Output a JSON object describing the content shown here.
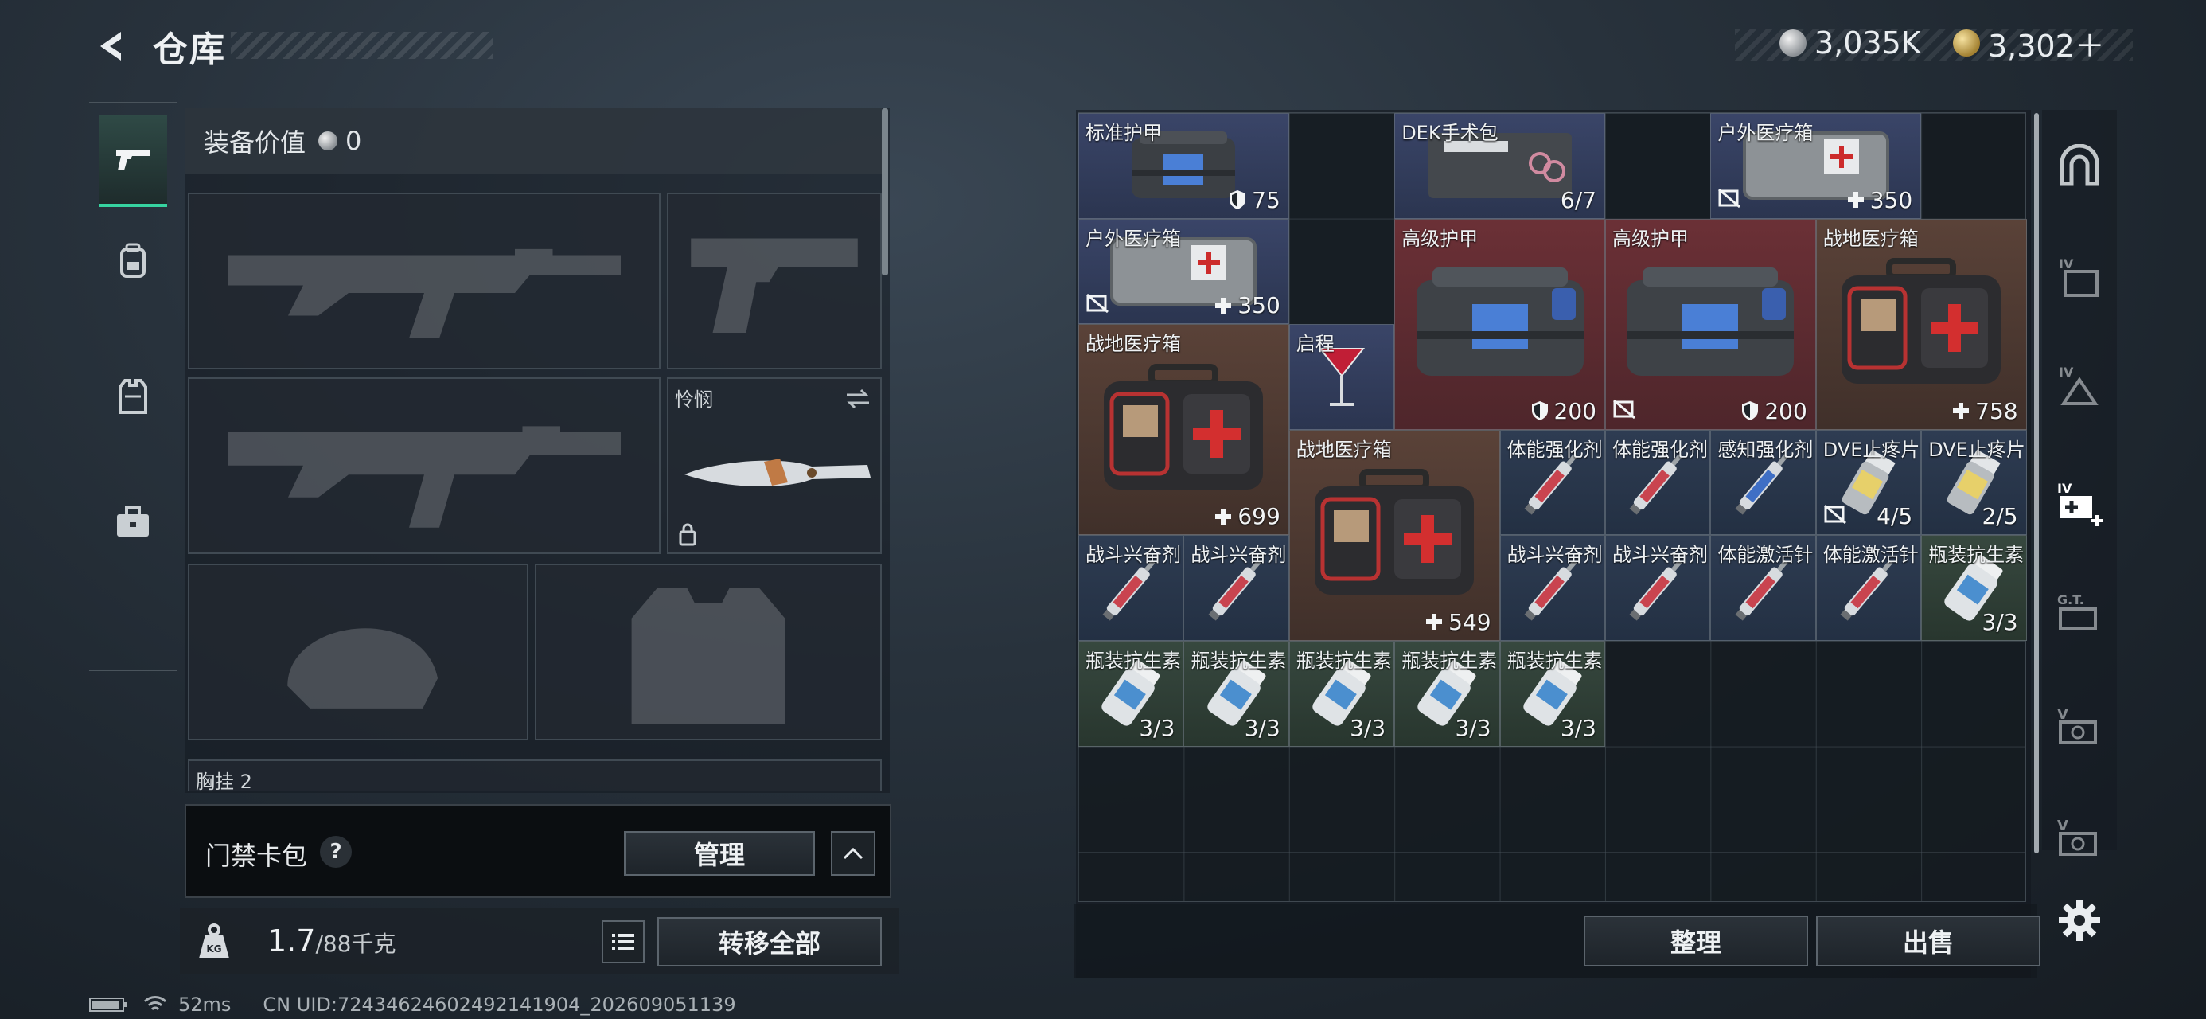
{
  "header": {
    "title": "仓库",
    "currency": [
      {
        "icon": "silver-coin-icon",
        "value": "3,035K"
      },
      {
        "icon": "gold-coin-icon",
        "value": "3,302＋"
      }
    ]
  },
  "left_tabs": [
    {
      "name": "tab-weapons",
      "icon": "pistol-icon",
      "active": true
    },
    {
      "name": "tab-backpack",
      "icon": "backpack-icon"
    },
    {
      "name": "tab-vest",
      "icon": "vest-icon"
    },
    {
      "name": "tab-case",
      "icon": "briefcase-icon"
    }
  ],
  "equipment": {
    "value_label": "装备价值",
    "value": "0",
    "melee_label": "怜悯",
    "chest_rig_label": "胸挂",
    "chest_rig_count": "2"
  },
  "keycard": {
    "label": "门禁卡包",
    "help": "?",
    "manage_label": "管理"
  },
  "weight": {
    "current": "1.7",
    "max": "/88千克",
    "icon_text": "KG",
    "transfer_all_label": "转移全部"
  },
  "status": {
    "ping": "52ms",
    "uid": "CN UID:72434624602492141904_202609051139"
  },
  "inventory": {
    "items": [
      {
        "name": "标准护甲",
        "value": "75",
        "mark": "shield",
        "color": "blue",
        "art": "armor-blue"
      },
      {
        "name": "DEK手术包",
        "value": "6/7",
        "mark": "",
        "color": "blue",
        "art": "surgery-kit"
      },
      {
        "name": "户外医疗箱",
        "value": "350",
        "mark": "plus",
        "color": "blue",
        "art": "medkit-gray",
        "nolock": true
      },
      {
        "name": "户外医疗箱",
        "value": "350",
        "mark": "plus",
        "color": "blue",
        "art": "medkit-gray",
        "nolock": true
      },
      {
        "name": "高级护甲",
        "value": "200",
        "mark": "shield",
        "color": "red",
        "art": "armor-large"
      },
      {
        "name": "高级护甲",
        "value": "200",
        "mark": "shield",
        "color": "red",
        "art": "armor-large",
        "nolock": true
      },
      {
        "name": "战地医疗箱",
        "value": "758",
        "mark": "plus",
        "color": "brown",
        "art": "firstaid"
      },
      {
        "name": "战地医疗箱",
        "value": "699",
        "mark": "plus",
        "color": "brown",
        "art": "firstaid"
      },
      {
        "name": "启程",
        "value": "",
        "mark": "",
        "color": "blue",
        "art": "cocktail"
      },
      {
        "name": "战地医疗箱",
        "value": "549",
        "mark": "plus",
        "color": "brown",
        "art": "firstaid"
      },
      {
        "name": "体能强化剂",
        "value": "",
        "mark": "",
        "color": "navy",
        "art": "syringe-red"
      },
      {
        "name": "体能强化剂",
        "value": "",
        "mark": "",
        "color": "navy",
        "art": "syringe-red"
      },
      {
        "name": "感知强化剂",
        "value": "",
        "mark": "",
        "color": "navy",
        "art": "syringe-blue"
      },
      {
        "name": "DVE止疼片",
        "value": "4/5",
        "mark": "",
        "color": "navy",
        "art": "pills",
        "nolock": true
      },
      {
        "name": "DVE止疼片",
        "value": "2/5",
        "mark": "",
        "color": "navy",
        "art": "pills"
      },
      {
        "name": "战斗兴奋剂",
        "value": "",
        "mark": "",
        "color": "navy",
        "art": "syringe-red"
      },
      {
        "name": "战斗兴奋剂",
        "value": "",
        "mark": "",
        "color": "navy",
        "art": "syringe-red"
      },
      {
        "name": "战斗兴奋剂",
        "value": "",
        "mark": "",
        "color": "navy",
        "art": "syringe-red"
      },
      {
        "name": "战斗兴奋剂",
        "value": "",
        "mark": "",
        "color": "navy",
        "art": "syringe-red"
      },
      {
        "name": "体能激活针",
        "value": "",
        "mark": "",
        "color": "navy",
        "art": "syringe-red"
      },
      {
        "name": "体能激活针",
        "value": "",
        "mark": "",
        "color": "navy",
        "art": "syringe-red"
      },
      {
        "name": "瓶装抗生素",
        "value": "3/3",
        "mark": "",
        "color": "green",
        "art": "bottle"
      },
      {
        "name": "瓶装抗生素",
        "value": "3/3",
        "mark": "",
        "color": "green",
        "art": "bottle"
      },
      {
        "name": "瓶装抗生素",
        "value": "3/3",
        "mark": "",
        "color": "green",
        "art": "bottle"
      },
      {
        "name": "瓶装抗生素",
        "value": "3/3",
        "mark": "",
        "color": "green",
        "art": "bottle"
      },
      {
        "name": "瓶装抗生素",
        "value": "3/3",
        "mark": "",
        "color": "green",
        "art": "bottle"
      },
      {
        "name": "瓶装抗生素",
        "value": "3/3",
        "mark": "",
        "color": "green",
        "art": "bottle"
      }
    ],
    "sort_label": "整理",
    "sell_label": "出售"
  },
  "right_tabs": [
    {
      "name": "rtab-home",
      "icon": "arch-icon"
    },
    {
      "name": "rtab-iv-1",
      "icon": "iv-folder-icon"
    },
    {
      "name": "rtab-iv-2",
      "icon": "iv-triangle-icon"
    },
    {
      "name": "rtab-iv-add",
      "icon": "iv-add-icon",
      "active": true
    },
    {
      "name": "rtab-gt",
      "icon": "gt-icon"
    },
    {
      "name": "rtab-v-1",
      "icon": "v-gear-icon"
    },
    {
      "name": "rtab-v-2",
      "icon": "v-gear-icon"
    }
  ],
  "colors": {
    "accent": "#36d3a0",
    "blue_rarity": "#3a4568",
    "red_rarity": "#6b3036",
    "brown_rarity": "#5a4238",
    "green_rarity": "#37483f"
  }
}
